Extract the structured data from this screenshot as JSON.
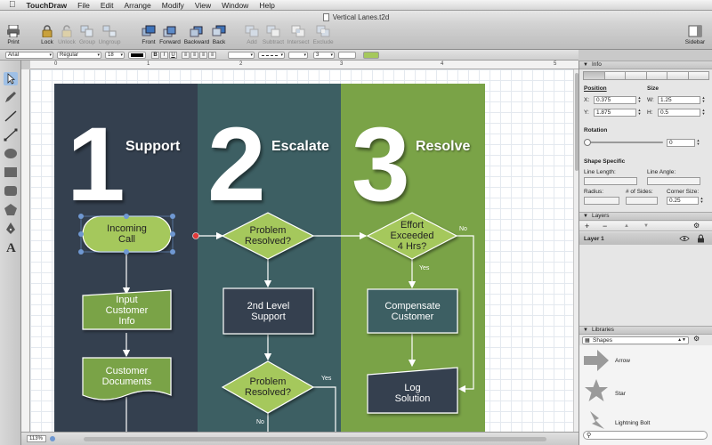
{
  "menubar": {
    "app_name": "TouchDraw",
    "items": [
      "File",
      "Edit",
      "Arrange",
      "Modify",
      "View",
      "Window",
      "Help"
    ]
  },
  "window": {
    "title": "Vertical Lanes.t2d"
  },
  "toolbar": {
    "print": "Print",
    "lock": "Lock",
    "unlock": "Unlock",
    "group": "Group",
    "ungroup": "Ungroup",
    "front": "Front",
    "forward": "Forward",
    "backward": "Backward",
    "back": "Back",
    "add": "Add",
    "subtract": "Subtract",
    "intersect": "Intersect",
    "exclude": "Exclude",
    "sidebar": "Sidebar"
  },
  "formatbar": {
    "font_family": "Arial",
    "font_style": "Regular",
    "font_size": "18",
    "bold": "B",
    "italic": "I",
    "underline": "U",
    "stroke_width": "3",
    "text_color": "#000000",
    "fill_color": "#a5c85c"
  },
  "canvas": {
    "zoom": "113%"
  },
  "ruler": {
    "marks": [
      "0",
      "1",
      "2",
      "3",
      "4",
      "5"
    ]
  },
  "diagram": {
    "lanes": [
      {
        "number": "1",
        "title": "Support",
        "color": "#34404f"
      },
      {
        "number": "2",
        "title": "Escalate",
        "color": "#3d5f63"
      },
      {
        "number": "3",
        "title": "Resolve",
        "color": "#7aa347"
      }
    ],
    "nodes": {
      "incoming_call": "Incoming\nCall",
      "input_customer_info": "Input\nCustomer\nInfo",
      "customer_documents": "Customer\nDocuments",
      "problem_resolved_1": "Problem\nResolved?",
      "second_level_support": "2nd Level\nSupport",
      "problem_resolved_2": "Problem\nResolved?",
      "effort_exceeded": "Effort\nExceeded\n4 Hrs?",
      "compensate_customer": "Compensate\nCustomer",
      "log_solution": "Log\nSolution"
    },
    "labels": {
      "no_1": "No",
      "yes_1": "Yes",
      "yes_2": "Yes",
      "no_2": "No"
    }
  },
  "inspector": {
    "info_title": "Info",
    "position_label": "Position",
    "size_label": "Size",
    "x_label": "X:",
    "x_value": "0.375",
    "y_label": "Y:",
    "y_value": "1.875",
    "w_label": "W:",
    "w_value": "1.25",
    "h_label": "H:",
    "h_value": "0.5",
    "rotation_label": "Rotation",
    "rotation_value": "0",
    "shape_specific_label": "Shape Specific",
    "line_length_label": "Line Length:",
    "line_angle_label": "Line Angle:",
    "radius_label": "Radius:",
    "sides_label": "# of Sides:",
    "corner_size_label": "Corner Size:",
    "corner_size_value": "0.25"
  },
  "layers": {
    "title": "Layers",
    "items": [
      {
        "name": "Layer 1"
      }
    ]
  },
  "libraries": {
    "title": "Libraries",
    "selected": "Shapes",
    "items": [
      "Arrow",
      "Star",
      "Lightning Bolt"
    ]
  }
}
